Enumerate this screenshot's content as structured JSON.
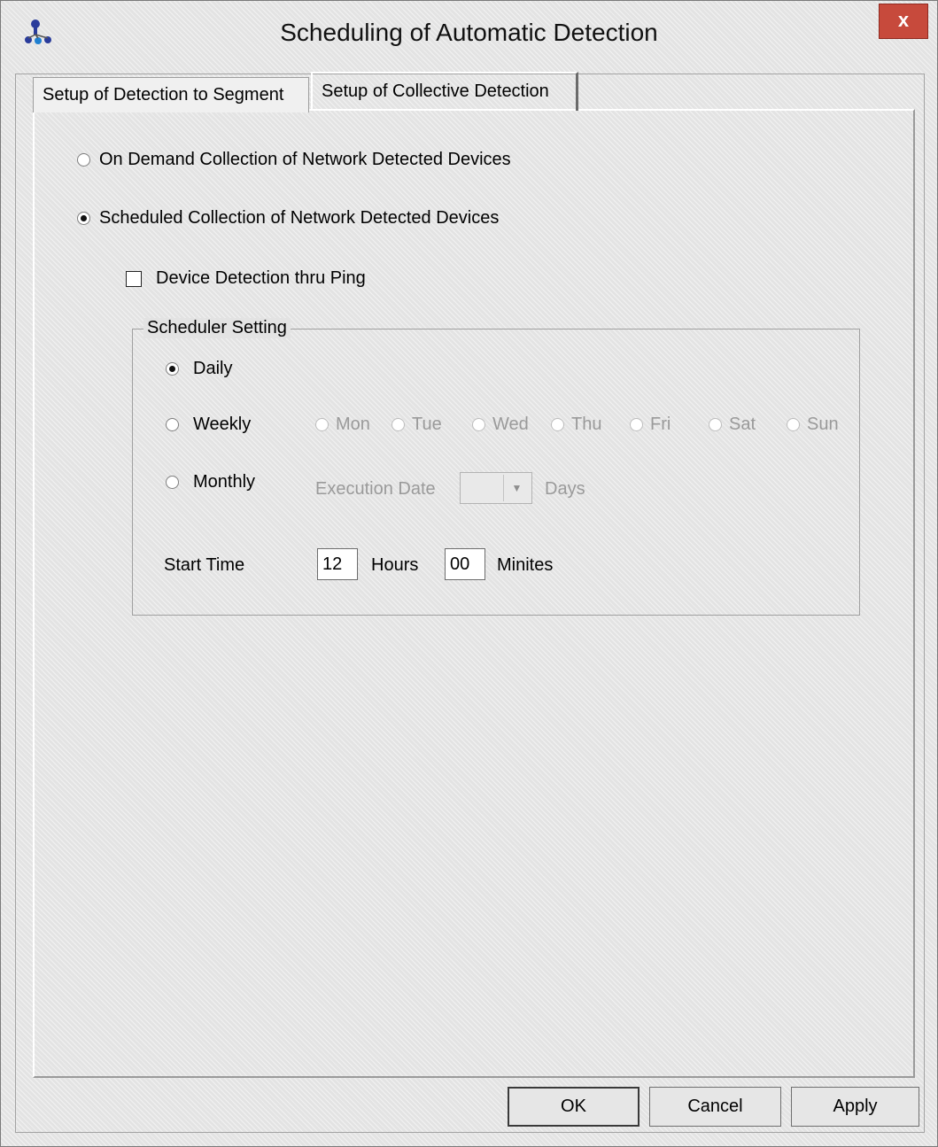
{
  "window": {
    "title": "Scheduling of Automatic Detection",
    "close_glyph": "x",
    "app_icon": "network-tool-icon"
  },
  "tabs": [
    {
      "label": "Setup of Detection to Segment",
      "active": false
    },
    {
      "label": "Setup of Collective Detection",
      "active": true
    }
  ],
  "collection_mode": {
    "on_demand_label": "On Demand Collection of Network Detected Devices",
    "scheduled_label": "Scheduled Collection of Network Detected Devices",
    "selected": "scheduled"
  },
  "ping_detection": {
    "label": "Device Detection thru Ping",
    "checked": false
  },
  "scheduler": {
    "group_label": "Scheduler Setting",
    "frequency_selected": "daily",
    "daily_label": "Daily",
    "weekly_label": "Weekly",
    "monthly_label": "Monthly",
    "weekdays": [
      "Mon",
      "Tue",
      "Wed",
      "Thu",
      "Fri",
      "Sat",
      "Sun"
    ],
    "execution_date_label": "Execution Date",
    "execution_date_value": "",
    "days_label": "Days",
    "start_time_label": "Start Time",
    "hours_value": "12",
    "hours_label": "Hours",
    "minutes_value": "00",
    "minutes_label": "Minites"
  },
  "buttons": {
    "ok": "OK",
    "cancel": "Cancel",
    "apply": "Apply"
  }
}
